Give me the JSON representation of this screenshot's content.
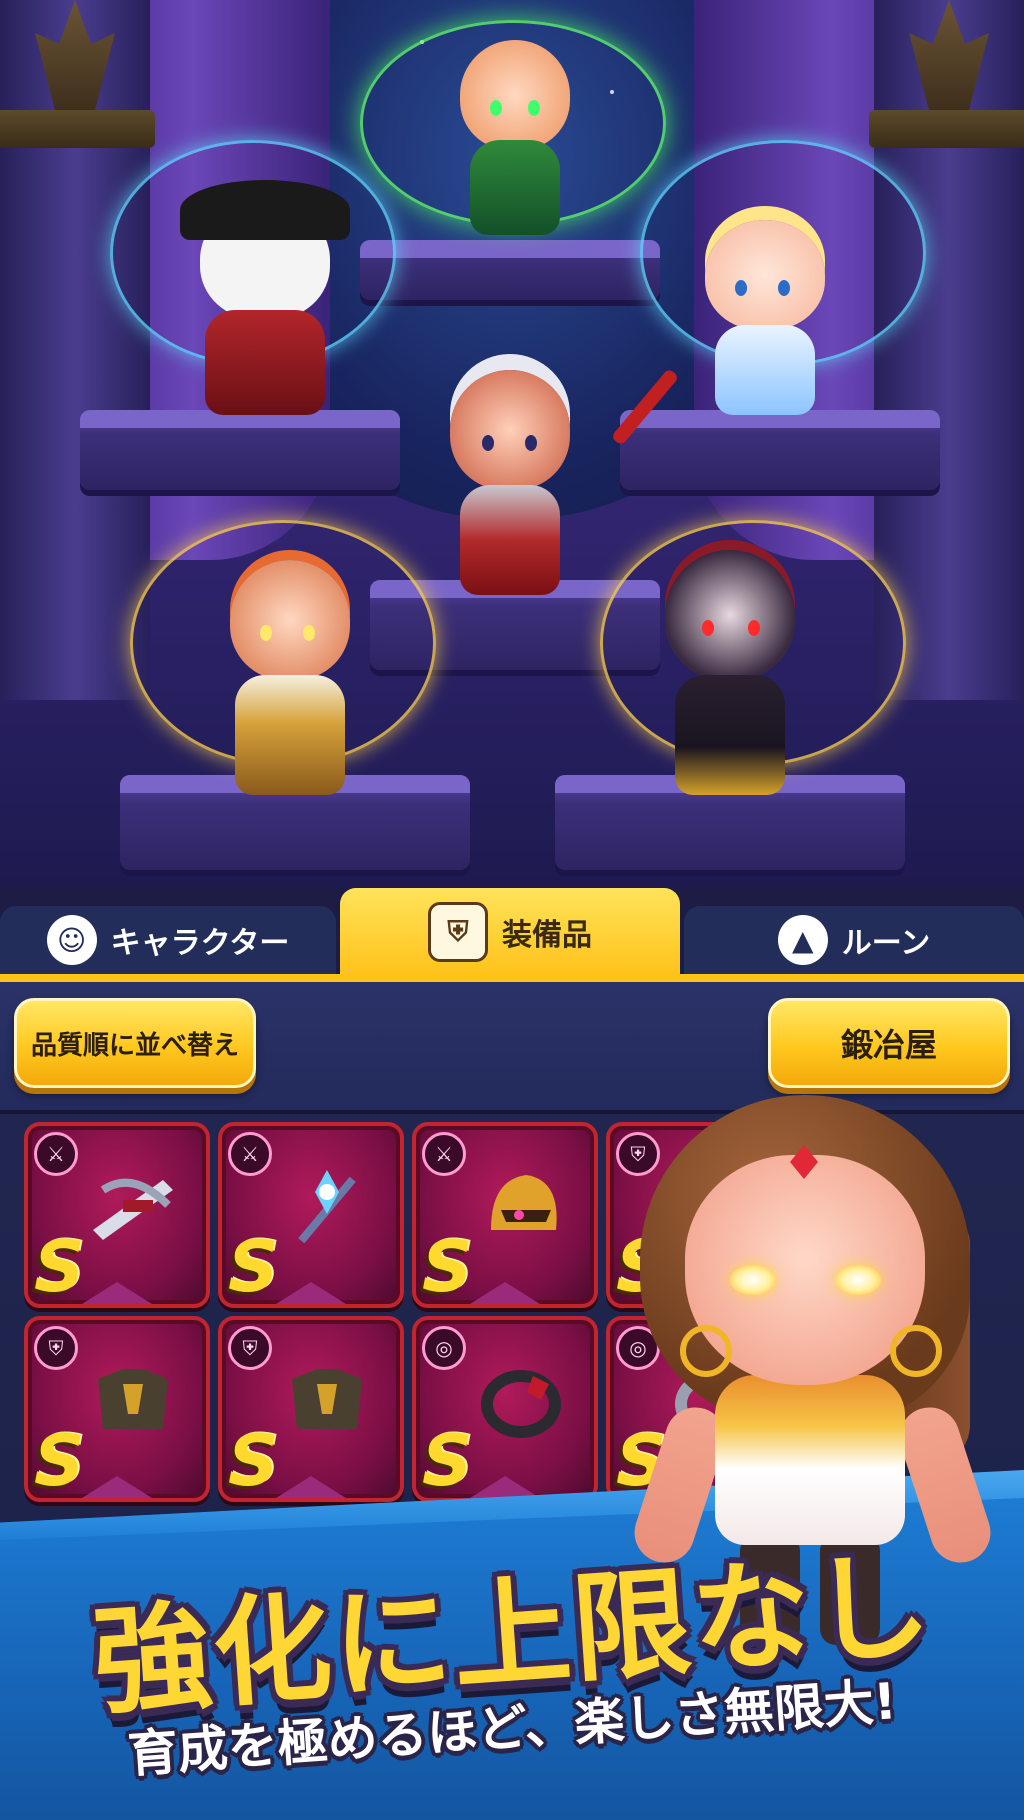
{
  "tabs": [
    {
      "label": "キャラクター",
      "icon": "character-face-icon",
      "active": false
    },
    {
      "label": "装備品",
      "icon": "armor-chest-icon",
      "active": true
    },
    {
      "label": "ルーン",
      "icon": "rune-icon",
      "active": false
    }
  ],
  "toolbar": {
    "sort_button": "品質順に並べ替え",
    "blacksmith_button": "鍛冶屋"
  },
  "equipment": [
    {
      "grade": "S",
      "category": "weapon",
      "item": "crossbow-icon"
    },
    {
      "grade": "S",
      "category": "weapon",
      "item": "staff-icon"
    },
    {
      "grade": "S",
      "category": "weapon",
      "item": "helmet-icon"
    },
    {
      "grade": "S",
      "category": "armor",
      "item": "armor-icon"
    },
    {
      "grade": "S",
      "category": "armor",
      "item": "armor-icon"
    },
    {
      "grade": "S",
      "category": "armor",
      "item": "armor-icon"
    },
    {
      "grade": "S",
      "category": "ring",
      "item": "ring-icon"
    },
    {
      "grade": "S",
      "category": "ring",
      "item": "ring-icon"
    }
  ],
  "banner": {
    "headline": "強化に上限なし",
    "subline": "育成を極めるほど、楽しさ無限大!"
  },
  "colors": {
    "accent_yellow": "#ffc21a",
    "slot_red": "#c22430",
    "banner_blue": "#1e7fd6",
    "grade_gold": "#ffd92e"
  }
}
